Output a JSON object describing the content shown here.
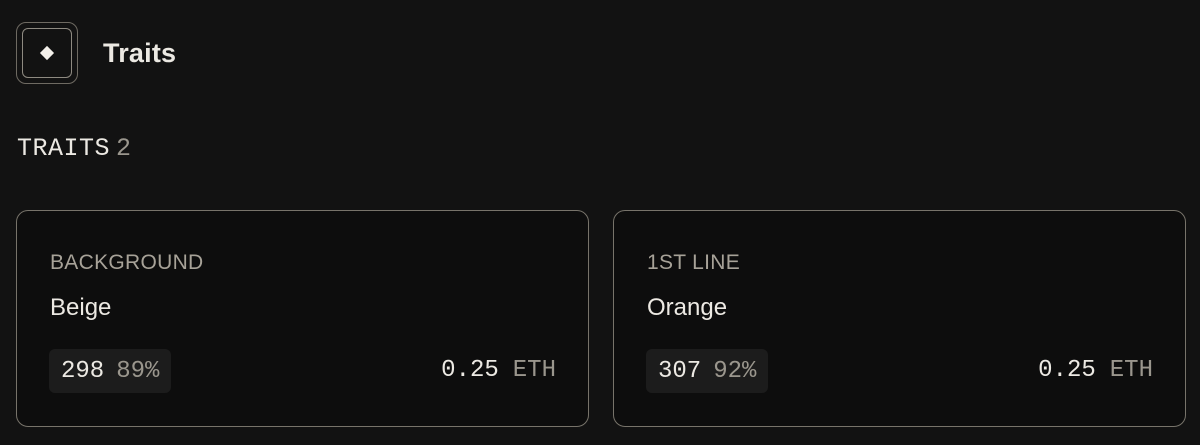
{
  "header": {
    "title": "Traits",
    "icon": "diamond-icon"
  },
  "section": {
    "label": "TRAITS",
    "count": "2"
  },
  "traits": [
    {
      "type": "BACKGROUND",
      "value": "Beige",
      "count": "298",
      "percent": "89%",
      "price": "0.25",
      "unit": "ETH"
    },
    {
      "type": "1ST LINE",
      "value": "Orange",
      "count": "307",
      "percent": "92%",
      "price": "0.25",
      "unit": "ETH"
    }
  ],
  "colors": {
    "background": "#121212",
    "card_border": "#77736a",
    "text_primary": "#ece9e3",
    "text_muted": "#9a968d"
  }
}
